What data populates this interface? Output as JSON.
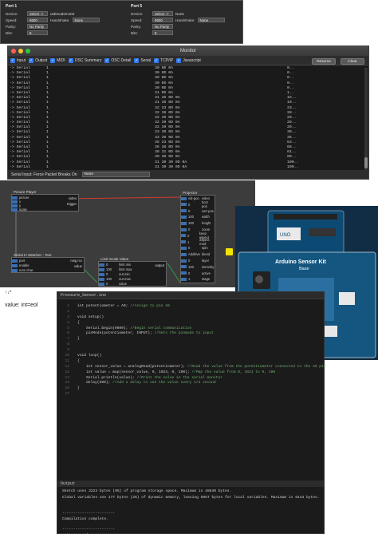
{
  "ports": [
    {
      "title": "Port 1",
      "device_label": "Device:",
      "device_select": "Select ->",
      "device_value": "usbmodem102",
      "speed_label": "Speed:",
      "speed_value": "9600",
      "handshake_label": "Handshake:",
      "handshake_value": "None",
      "parity_label": "Parity:",
      "parity_value": "No Parity",
      "bits_label": "Bits:",
      "bits_value": "8"
    },
    {
      "title": "Port 5",
      "device_label": "Device:",
      "device_select": "Select ->",
      "device_value": "None",
      "speed_label": "Speed:",
      "speed_value": "9600",
      "handshake_label": "Handshake:",
      "handshake_value": "None",
      "parity_label": "Parity:",
      "parity_value": "No Parity",
      "bits_label": "Bits:",
      "bits_value": "8"
    }
  ],
  "monitor": {
    "title": "Monitor",
    "tabs": [
      "Input",
      "Output",
      "MIDI",
      "OSC Summary",
      "OSC Detail",
      "Serial",
      "TCP/IP",
      "Javascript"
    ],
    "resume": "Resume",
    "clear": "Clear",
    "rows": [
      [
        "-> Serial",
        "1",
        "30 0D 0A",
        "0.."
      ],
      [
        "-> Serial",
        "1",
        "30 0D 0A",
        "0.."
      ],
      [
        "-> Serial",
        "1",
        "30 0D 0A",
        "0.."
      ],
      [
        "-> Serial",
        "1",
        "30 0D 0A",
        "0.."
      ],
      [
        "-> Serial",
        "1",
        "30 0D 0A",
        "0.."
      ],
      [
        "-> Serial",
        "1",
        "31 0D 0A",
        "1.."
      ],
      [
        "-> Serial",
        "1",
        "31 35 0D 0A",
        "15.."
      ],
      [
        "-> Serial",
        "1",
        "31 39 0D 0A",
        "19.."
      ],
      [
        "-> Serial",
        "1",
        "32 33 0D 0A",
        "23.."
      ],
      [
        "-> Serial",
        "1",
        "32 38 0D 0A",
        "28.."
      ],
      [
        "-> Serial",
        "1",
        "32 39 0D 0A",
        "29.."
      ],
      [
        "-> Serial",
        "1",
        "32 39 0D 0A",
        "29.."
      ],
      [
        "-> Serial",
        "1",
        "32 39 0D 0A",
        "29.."
      ],
      [
        "-> Serial",
        "1",
        "33 30 0D 0A",
        "30.."
      ],
      [
        "-> Serial",
        "1",
        "33 36 0D 0A",
        "36.."
      ],
      [
        "-> Serial",
        "1",
        "35 33 0D 0A",
        "53.."
      ],
      [
        "-> Serial",
        "1",
        "36 38 0D 0A",
        "68.."
      ],
      [
        "-> Serial",
        "1",
        "38 31 0D 0A",
        "81.."
      ],
      [
        "-> Serial",
        "1",
        "39 30 0D 0A",
        "90.."
      ],
      [
        "-> Serial",
        "1",
        "31 30 30 0D 0A",
        "100.."
      ],
      [
        "-> Serial",
        "1",
        "31 30 30 0D 0A",
        "100.."
      ]
    ],
    "footer_label": "Serial Input: Force Packet Breaks On",
    "footer_select": "None"
  },
  "patch": {
    "picture_player": {
      "title": "Picture Player",
      "ports": [
        "picture",
        "x",
        "y",
        "scale"
      ],
      "out": [
        "video",
        "trigger"
      ]
    },
    "serial_watcher": {
      "title": "Serial In Watcher - Text",
      "ports": [
        "port",
        "enable",
        "eom char"
      ],
      "out": [
        "msg rcv",
        "value"
      ]
    },
    "limit_scale": {
      "title": "Limit Scale Value",
      "ports": [
        "limit min",
        "limit max",
        "out min",
        "out max",
        "value"
      ],
      "vals": [
        "0",
        "100",
        "0",
        "100",
        "0"
      ],
      "out": "output"
    },
    "projector": {
      "title": "Projector",
      "ports": [
        "video",
        "horz pos",
        "vert pos",
        "width",
        "height",
        "zoom",
        "keep aspect",
        "aspect mod",
        "spin",
        "blend",
        "layer",
        "intensity",
        "active",
        "stage"
      ],
      "vals": [
        "vid-goo",
        "0",
        "0",
        "100",
        "100",
        "0",
        "0",
        "1",
        "0",
        "Additive",
        "0",
        "100",
        "0",
        "1"
      ]
    }
  },
  "photo": {
    "board_title": "Arduino Sensor Kit",
    "board_subtitle": "Base",
    "uno_label": "UNO"
  },
  "side": {
    "label1": "↑↓*",
    "label2": "value: int=eol"
  },
  "editor": {
    "tab": "Pressure_Sensor.ino",
    "lines": [
      {
        "n": "1",
        "t": "int potentiometer = A0; //Assign to pin A0"
      },
      {
        "n": "2",
        "t": ""
      },
      {
        "n": "3",
        "t": "void setup()"
      },
      {
        "n": "4",
        "t": "{"
      },
      {
        "n": "5",
        "t": "    Serial.begin(9600); //Begin serial communication"
      },
      {
        "n": "6",
        "t": "    pinMode(potentiometer, INPUT); //Sets the pinmode to input"
      },
      {
        "n": "7",
        "t": "}"
      },
      {
        "n": "8",
        "t": ""
      },
      {
        "n": "9",
        "t": ""
      },
      {
        "n": "10",
        "t": "void loop()"
      },
      {
        "n": "11",
        "t": "{"
      },
      {
        "n": "12",
        "t": "    int sensor_value = analogRead(potentiometer); //Read the value from the potentiometer connected to the A0 pin"
      },
      {
        "n": "13",
        "t": "    int value = map(sensor_value, 0, 1023, 0, 100); //Map the value from 0, 1023 to 0, 100"
      },
      {
        "n": "14",
        "t": "    Serial.println(value); //Print the value in the serial monitor"
      },
      {
        "n": "15",
        "t": "    delay(500); //Add a delay to see the value every 1/2 second"
      },
      {
        "n": "16",
        "t": "}"
      },
      {
        "n": "17",
        "t": ""
      }
    ],
    "output_title": "Output",
    "output": [
      "Sketch uses 3223 bytes (9%) of program storage space. Maximum is 48640 bytes.",
      "Global variables use 177 bytes (2%) of dynamic memory, leaving 5967 bytes for local variables. Maximum is 6144 bytes.",
      "------------------------",
      "Compilation complete.",
      "------------------------",
      "upload complete."
    ]
  }
}
